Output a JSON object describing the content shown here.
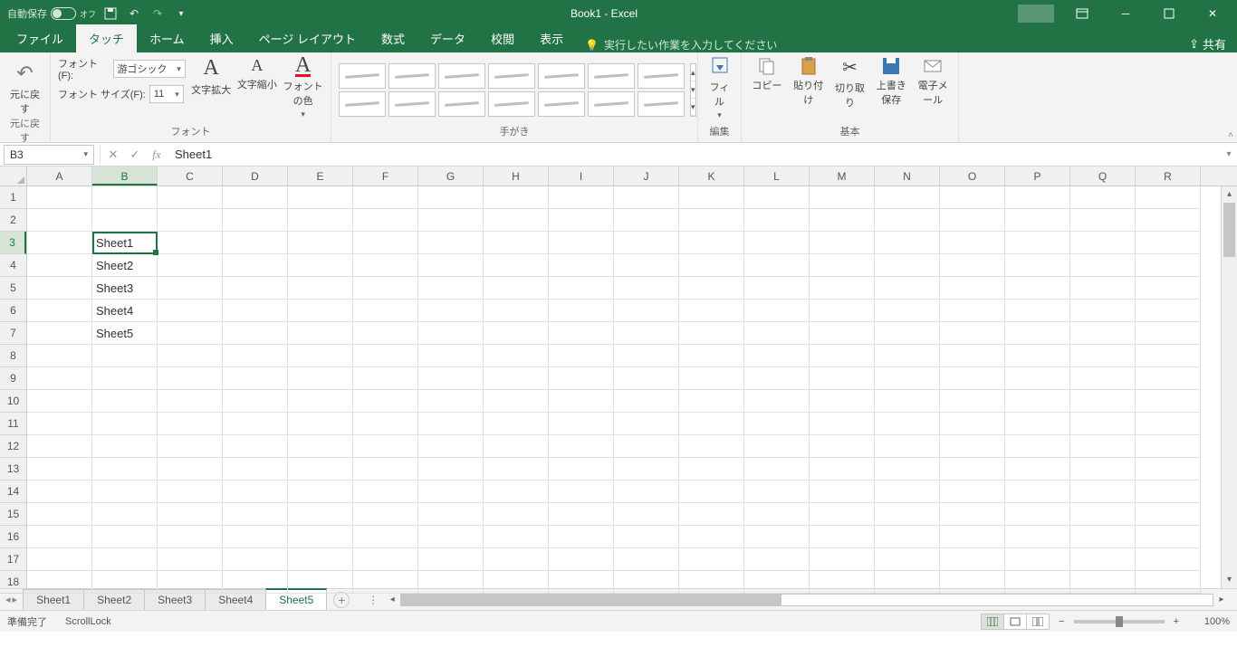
{
  "titlebar": {
    "autosave_label": "自動保存",
    "autosave_state": "オフ",
    "title": "Book1  -  Excel"
  },
  "tabs": {
    "file": "ファイル",
    "touch": "タッチ",
    "home": "ホーム",
    "insert": "挿入",
    "layout": "ページ レイアウト",
    "formulas": "数式",
    "data": "データ",
    "review": "校閲",
    "view": "表示",
    "tellme": "実行したい作業を入力してください",
    "share": "共有"
  },
  "ribbon": {
    "undo": {
      "label": "元に戻す",
      "group": "元に戻す"
    },
    "font": {
      "font_label": "フォント(F):",
      "font_value": "游ゴシック",
      "size_label": "フォント サイズ(F):",
      "size_value": "11",
      "grow": "文字拡大",
      "shrink": "文字縮小",
      "color": "フォントの色",
      "group": "フォント"
    },
    "ink": {
      "group": "手がき"
    },
    "edit": {
      "fill": "フィル",
      "group": "編集"
    },
    "basic": {
      "copy": "コピー",
      "paste": "貼り付け",
      "cut": "切り取り",
      "save": "上書き保存",
      "email": "電子メール",
      "group": "基本"
    }
  },
  "fbar": {
    "name": "B3",
    "formula": "Sheet1"
  },
  "columns": [
    "A",
    "B",
    "C",
    "D",
    "E",
    "F",
    "G",
    "H",
    "I",
    "J",
    "K",
    "L",
    "M",
    "N",
    "O",
    "P",
    "Q",
    "R"
  ],
  "rows": [
    1,
    2,
    3,
    4,
    5,
    6,
    7,
    8,
    9,
    10,
    11,
    12,
    13,
    14,
    15,
    16,
    17,
    18
  ],
  "cells": {
    "B3": "Sheet1",
    "B4": "Sheet2",
    "B5": "Sheet3",
    "B6": "Sheet4",
    "B7": "Sheet5"
  },
  "active_cell": {
    "col": "B",
    "row": 3
  },
  "sheets": [
    "Sheet1",
    "Sheet2",
    "Sheet3",
    "Sheet4",
    "Sheet5"
  ],
  "active_sheet": "Sheet5",
  "status": {
    "ready": "準備完了",
    "scroll": "ScrollLock",
    "zoom": "100%"
  }
}
